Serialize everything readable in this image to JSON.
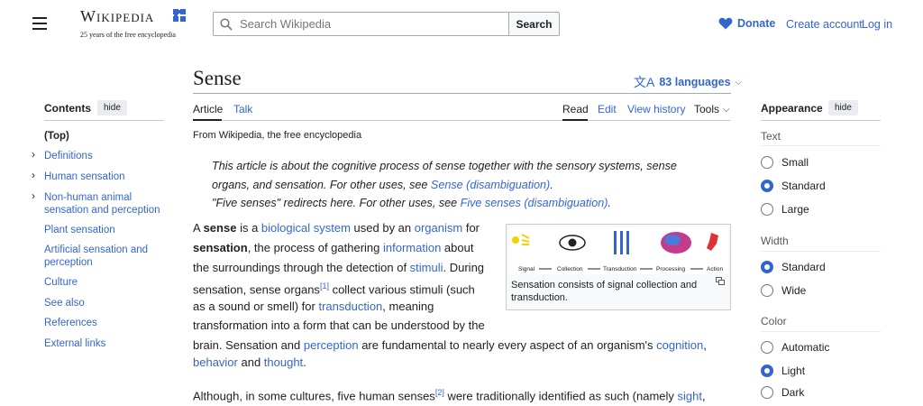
{
  "header": {
    "logo_word": "Wikipedia",
    "logo_tagline": "25 years of the free encyclopedia",
    "search_placeholder": "Search Wikipedia",
    "search_button": "Search",
    "donate": "Donate",
    "create_account": "Create account",
    "log_in": "Log in"
  },
  "toc": {
    "title": "Contents",
    "hide": "hide",
    "items": [
      {
        "label": "(Top)"
      },
      {
        "label": "Definitions"
      },
      {
        "label": "Human sensation"
      },
      {
        "label": "Non-human animal sensation and perception"
      },
      {
        "label": "Plant sensation"
      },
      {
        "label": "Artificial sensation and perception"
      },
      {
        "label": "Culture"
      },
      {
        "label": "See also"
      },
      {
        "label": "References"
      },
      {
        "label": "External links"
      }
    ]
  },
  "article": {
    "title": "Sense",
    "languages": "83 languages",
    "tabs": {
      "article": "Article",
      "talk": "Talk",
      "read": "Read",
      "edit": "Edit",
      "history": "View history",
      "tools": "Tools"
    },
    "from": "From Wikipedia, the free encyclopedia",
    "hatnote1": {
      "text": "This article is about the cognitive process of sense together with the sensory systems, sense organs, and sensation. For other uses, see ",
      "link": "Sense (disambiguation)",
      "end": "."
    },
    "hatnote2": {
      "text": "\"Five senses\" redirects here. For other uses, see ",
      "link": "Five senses (disambiguation)",
      "end": "."
    },
    "p1": {
      "a": "A ",
      "b": "sense",
      "c": " is a ",
      "l1": "biological system",
      "d": " used by an ",
      "l2": "organism",
      "e": " for",
      "f": "sensation",
      "g": ", the process of gathering ",
      "l3": "information",
      "h": " about",
      "i": "the surroundings through the detection of ",
      "l4": "stimuli",
      "j": ". During",
      "k": "sensation, sense organs",
      "ref1": "[1]",
      "m": " collect various stimuli (such",
      "n": "as a sound or smell) for ",
      "l5": "transduction",
      "o": ", meaning",
      "p": "transformation into a form that can be understood by the",
      "q": "brain. Sensation and ",
      "l6": "perception",
      "r": " are fundamental to nearly every aspect of an organism's ",
      "l7": "cognition",
      "s": ",",
      "l8": "behavior",
      "t": " and ",
      "l9": "thought",
      "u": "."
    },
    "p2": {
      "a": "Although, in some cultures, five human senses",
      "ref": "[2]",
      "b": " were traditionally identified as such (namely ",
      "l1": "sight",
      "c": ","
    },
    "figure": {
      "labels": [
        "Signal",
        "Collection",
        "Transduction",
        "Processing",
        "Action"
      ],
      "caption": "Sensation consists of signal collection and transduction."
    }
  },
  "appearance": {
    "title": "Appearance",
    "hide": "hide",
    "text_label": "Text",
    "text_options": [
      {
        "label": "Small",
        "checked": false
      },
      {
        "label": "Standard",
        "checked": true
      },
      {
        "label": "Large",
        "checked": false
      }
    ],
    "width_label": "Width",
    "width_options": [
      {
        "label": "Standard",
        "checked": true
      },
      {
        "label": "Wide",
        "checked": false
      }
    ],
    "color_label": "Color",
    "color_options": [
      {
        "label": "Automatic",
        "checked": false
      },
      {
        "label": "Light",
        "checked": true
      },
      {
        "label": "Dark",
        "checked": false
      }
    ]
  },
  "colors": {
    "link": "#3366cc",
    "text": "#202122",
    "border": "#a2a9b1"
  }
}
